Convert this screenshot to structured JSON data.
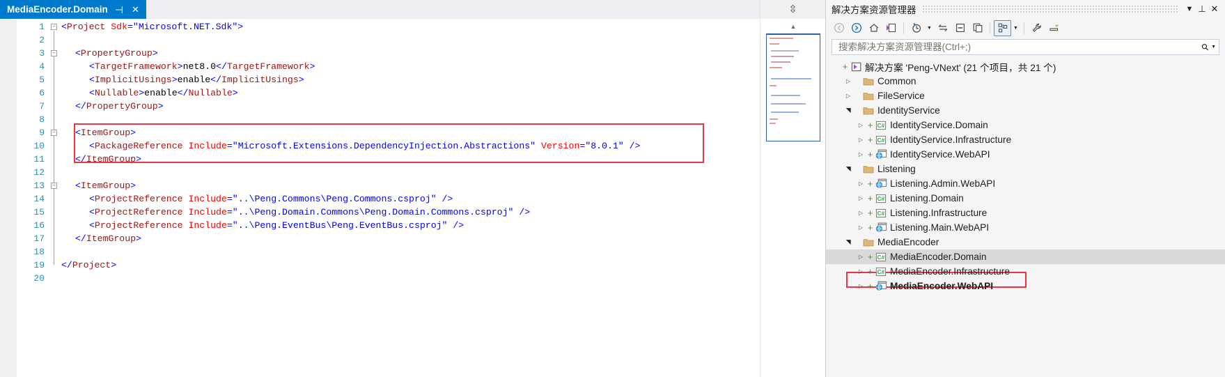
{
  "editor": {
    "tab": {
      "title": "MediaEncoder.Domain",
      "pin_icon": "pin-icon",
      "close_icon": "close-icon",
      "dropdown_icon": "chevron-down-icon",
      "settings_icon": "gear-icon",
      "split_icon": "split-view-icon"
    },
    "line_numbers": [
      "1",
      "2",
      "3",
      "4",
      "5",
      "6",
      "7",
      "8",
      "9",
      "10",
      "11",
      "12",
      "13",
      "14",
      "15",
      "16",
      "17",
      "18",
      "19",
      "20"
    ],
    "code_lines": [
      {
        "n": 1,
        "indent": 0,
        "tokens": [
          {
            "t": "<",
            "c": "blue"
          },
          {
            "t": "Project",
            "c": "dkred"
          },
          {
            "t": " ",
            "c": "plain"
          },
          {
            "t": "Sdk",
            "c": "red"
          },
          {
            "t": "=",
            "c": "blue"
          },
          {
            "t": "\"Microsoft.NET.Sdk\"",
            "c": "attrv"
          },
          {
            "t": ">",
            "c": "blue"
          }
        ]
      },
      {
        "n": 2,
        "indent": 0,
        "tokens": []
      },
      {
        "n": 3,
        "indent": 1,
        "tokens": [
          {
            "t": "<",
            "c": "blue"
          },
          {
            "t": "PropertyGroup",
            "c": "dkred"
          },
          {
            "t": ">",
            "c": "blue"
          }
        ]
      },
      {
        "n": 4,
        "indent": 2,
        "tokens": [
          {
            "t": "<",
            "c": "blue"
          },
          {
            "t": "TargetFramework",
            "c": "dkred"
          },
          {
            "t": ">",
            "c": "blue"
          },
          {
            "t": "net8.0",
            "c": "plain"
          },
          {
            "t": "</",
            "c": "blue"
          },
          {
            "t": "TargetFramework",
            "c": "dkred"
          },
          {
            "t": ">",
            "c": "blue"
          }
        ]
      },
      {
        "n": 5,
        "indent": 2,
        "tokens": [
          {
            "t": "<",
            "c": "blue"
          },
          {
            "t": "ImplicitUsings",
            "c": "dkred"
          },
          {
            "t": ">",
            "c": "blue"
          },
          {
            "t": "enable",
            "c": "plain"
          },
          {
            "t": "</",
            "c": "blue"
          },
          {
            "t": "ImplicitUsings",
            "c": "dkred"
          },
          {
            "t": ">",
            "c": "blue"
          }
        ]
      },
      {
        "n": 6,
        "indent": 2,
        "tokens": [
          {
            "t": "<",
            "c": "blue"
          },
          {
            "t": "Nullable",
            "c": "dkred"
          },
          {
            "t": ">",
            "c": "blue"
          },
          {
            "t": "enable",
            "c": "plain"
          },
          {
            "t": "</",
            "c": "blue"
          },
          {
            "t": "Nullable",
            "c": "dkred"
          },
          {
            "t": ">",
            "c": "blue"
          }
        ]
      },
      {
        "n": 7,
        "indent": 1,
        "tokens": [
          {
            "t": "</",
            "c": "blue"
          },
          {
            "t": "PropertyGroup",
            "c": "dkred"
          },
          {
            "t": ">",
            "c": "blue"
          }
        ]
      },
      {
        "n": 8,
        "indent": 0,
        "tokens": []
      },
      {
        "n": 9,
        "indent": 1,
        "tokens": [
          {
            "t": "<",
            "c": "blue"
          },
          {
            "t": "ItemGroup",
            "c": "dkred"
          },
          {
            "t": ">",
            "c": "blue"
          }
        ]
      },
      {
        "n": 10,
        "indent": 2,
        "tokens": [
          {
            "t": "<",
            "c": "blue"
          },
          {
            "t": "PackageReference",
            "c": "dkred"
          },
          {
            "t": " ",
            "c": "plain"
          },
          {
            "t": "Include",
            "c": "red"
          },
          {
            "t": "=",
            "c": "blue"
          },
          {
            "t": "\"Microsoft.Extensions.DependencyInjection.Abstractions\"",
            "c": "attrv"
          },
          {
            "t": " ",
            "c": "plain"
          },
          {
            "t": "Version",
            "c": "red"
          },
          {
            "t": "=",
            "c": "blue"
          },
          {
            "t": "\"8.0.1\"",
            "c": "attrv"
          },
          {
            "t": " />",
            "c": "blue"
          }
        ]
      },
      {
        "n": 11,
        "indent": 1,
        "tokens": [
          {
            "t": "</",
            "c": "blue"
          },
          {
            "t": "ItemGroup",
            "c": "dkred"
          },
          {
            "t": ">",
            "c": "blue"
          }
        ]
      },
      {
        "n": 12,
        "indent": 0,
        "tokens": []
      },
      {
        "n": 13,
        "indent": 1,
        "tokens": [
          {
            "t": "<",
            "c": "blue"
          },
          {
            "t": "ItemGroup",
            "c": "dkred"
          },
          {
            "t": ">",
            "c": "blue"
          }
        ]
      },
      {
        "n": 14,
        "indent": 2,
        "tokens": [
          {
            "t": "<",
            "c": "blue"
          },
          {
            "t": "ProjectReference",
            "c": "dkred"
          },
          {
            "t": " ",
            "c": "plain"
          },
          {
            "t": "Include",
            "c": "red"
          },
          {
            "t": "=",
            "c": "blue"
          },
          {
            "t": "\"..\\Peng.Commons\\Peng.Commons.csproj\"",
            "c": "attrv"
          },
          {
            "t": " />",
            "c": "blue"
          }
        ]
      },
      {
        "n": 15,
        "indent": 2,
        "tokens": [
          {
            "t": "<",
            "c": "blue"
          },
          {
            "t": "ProjectReference",
            "c": "dkred"
          },
          {
            "t": " ",
            "c": "plain"
          },
          {
            "t": "Include",
            "c": "red"
          },
          {
            "t": "=",
            "c": "blue"
          },
          {
            "t": "\"..\\Peng.Domain.Commons\\Peng.Domain.Commons.csproj\"",
            "c": "attrv"
          },
          {
            "t": " />",
            "c": "blue"
          }
        ]
      },
      {
        "n": 16,
        "indent": 2,
        "tokens": [
          {
            "t": "<",
            "c": "blue"
          },
          {
            "t": "ProjectReference",
            "c": "dkred"
          },
          {
            "t": " ",
            "c": "plain"
          },
          {
            "t": "Include",
            "c": "red"
          },
          {
            "t": "=",
            "c": "blue"
          },
          {
            "t": "\"..\\Peng.EventBus\\Peng.EventBus.csproj\"",
            "c": "attrv"
          },
          {
            "t": " />",
            "c": "blue"
          }
        ]
      },
      {
        "n": 17,
        "indent": 1,
        "tokens": [
          {
            "t": "</",
            "c": "blue"
          },
          {
            "t": "ItemGroup",
            "c": "dkred"
          },
          {
            "t": ">",
            "c": "blue"
          }
        ]
      },
      {
        "n": 18,
        "indent": 0,
        "tokens": []
      },
      {
        "n": 19,
        "indent": 0,
        "tokens": [
          {
            "t": "</",
            "c": "blue"
          },
          {
            "t": "Project",
            "c": "dkred"
          },
          {
            "t": ">",
            "c": "blue"
          }
        ]
      },
      {
        "n": 20,
        "indent": 0,
        "tokens": []
      }
    ],
    "annotation_color": "#ef3340"
  },
  "solution_explorer": {
    "title": "解决方案资源管理器",
    "title_dropdown_icon": "chevron-down-icon",
    "title_pin_icon": "pin-icon",
    "title_close_icon": "close-icon",
    "toolbar": [
      {
        "name": "back-icon",
        "glyph": "back"
      },
      {
        "name": "forward-icon",
        "glyph": "forward"
      },
      {
        "name": "home-icon",
        "glyph": "home"
      },
      {
        "name": "solution-icon",
        "glyph": "solution"
      },
      {
        "name": "pending-changes-icon",
        "glyph": "clock"
      },
      {
        "name": "sync-icon",
        "glyph": "sync"
      },
      {
        "name": "collapse-all-icon",
        "glyph": "collapse"
      },
      {
        "name": "new-view-icon",
        "glyph": "copy"
      },
      {
        "name": "show-all-files-icon",
        "glyph": "hierarchy"
      },
      {
        "name": "properties-icon",
        "glyph": "wrench"
      },
      {
        "name": "preview-icon",
        "glyph": "preview"
      }
    ],
    "search": {
      "placeholder": "搜索解决方案资源管理器(Ctrl+;)",
      "value": "",
      "icon": "search-icon",
      "dropdown_icon": "chevron-down-icon"
    },
    "tree": [
      {
        "depth": 0,
        "twist": "none",
        "plus": true,
        "icon": "solution",
        "label": "解决方案 'Peng-VNext' (21 个项目，共 21 个)",
        "bold": false,
        "selected": false
      },
      {
        "depth": 1,
        "twist": "closed",
        "plus": false,
        "icon": "folder",
        "label": "Common",
        "bold": false,
        "selected": false
      },
      {
        "depth": 1,
        "twist": "closed",
        "plus": false,
        "icon": "folder",
        "label": "FileService",
        "bold": false,
        "selected": false
      },
      {
        "depth": 1,
        "twist": "open",
        "plus": false,
        "icon": "folder",
        "label": "IdentityService",
        "bold": false,
        "selected": false
      },
      {
        "depth": 2,
        "twist": "closed",
        "plus": true,
        "icon": "csharp",
        "label": "IdentityService.Domain",
        "bold": false,
        "selected": false
      },
      {
        "depth": 2,
        "twist": "closed",
        "plus": true,
        "icon": "csharp",
        "label": "IdentityService.Infrastructure",
        "bold": false,
        "selected": false
      },
      {
        "depth": 2,
        "twist": "closed",
        "plus": true,
        "icon": "webapi",
        "label": "IdentityService.WebAPI",
        "bold": false,
        "selected": false
      },
      {
        "depth": 1,
        "twist": "open",
        "plus": false,
        "icon": "folder",
        "label": "Listening",
        "bold": false,
        "selected": false
      },
      {
        "depth": 2,
        "twist": "closed",
        "plus": true,
        "icon": "webapi",
        "label": "Listening.Admin.WebAPI",
        "bold": false,
        "selected": false
      },
      {
        "depth": 2,
        "twist": "closed",
        "plus": true,
        "icon": "csharp",
        "label": "Listening.Domain",
        "bold": false,
        "selected": false
      },
      {
        "depth": 2,
        "twist": "closed",
        "plus": true,
        "icon": "csharp",
        "label": "Listening.Infrastructure",
        "bold": false,
        "selected": false
      },
      {
        "depth": 2,
        "twist": "closed",
        "plus": true,
        "icon": "webapi",
        "label": "Listening.Main.WebAPI",
        "bold": false,
        "selected": false
      },
      {
        "depth": 1,
        "twist": "open",
        "plus": false,
        "icon": "folder",
        "label": "MediaEncoder",
        "bold": false,
        "selected": false
      },
      {
        "depth": 2,
        "twist": "closed",
        "plus": true,
        "icon": "csharp",
        "label": "MediaEncoder.Domain",
        "bold": false,
        "selected": true
      },
      {
        "depth": 2,
        "twist": "closed",
        "plus": true,
        "icon": "csharp",
        "label": "MediaEncoder.Infrastructure",
        "bold": false,
        "selected": false
      },
      {
        "depth": 2,
        "twist": "closed",
        "plus": true,
        "icon": "webapi",
        "label": "MediaEncoder.WebAPI",
        "bold": true,
        "selected": false
      }
    ],
    "annotation_color": "#ef3340"
  }
}
